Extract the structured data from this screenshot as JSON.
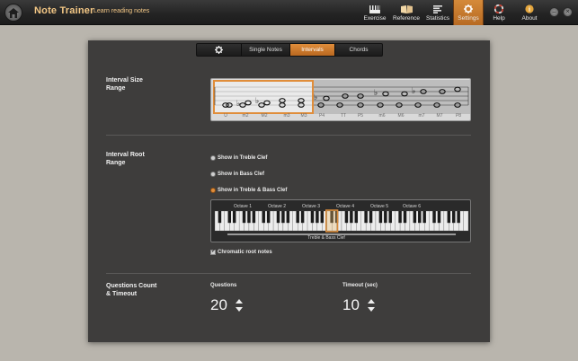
{
  "app": {
    "title": "Note Trainer",
    "subtitle": "Learn reading notes"
  },
  "nav": [
    {
      "label": "Exercise",
      "icon": "piano-icon"
    },
    {
      "label": "Reference",
      "icon": "book-icon"
    },
    {
      "label": "Statistics",
      "icon": "bars-icon"
    },
    {
      "label": "Settings",
      "icon": "gear-icon",
      "active": true
    },
    {
      "label": "Help",
      "icon": "lifebuoy-icon"
    },
    {
      "label": "About",
      "icon": "info-icon"
    }
  ],
  "tabs": [
    {
      "label": "",
      "icon": "gear-icon"
    },
    {
      "label": "Single Notes"
    },
    {
      "label": "Intervals",
      "active": true
    },
    {
      "label": "Chords"
    }
  ],
  "interval_size": {
    "label_line1": "Interval Size",
    "label_line2": "Range",
    "names": [
      "U",
      "m2",
      "M2",
      "m3",
      "M3",
      "P4",
      "TT",
      "P5",
      "m6",
      "M6",
      "m7",
      "M7",
      "P8"
    ],
    "selected_from": "U",
    "selected_to": "M3"
  },
  "interval_root": {
    "label_line1": "Interval Root",
    "label_line2": "Range",
    "options": [
      {
        "label": "Show in Treble Clef",
        "selected": false
      },
      {
        "label": "Show in Bass Clef",
        "selected": false
      },
      {
        "label": "Show in Treble & Bass Clef",
        "selected": true
      }
    ],
    "octaves": [
      "Octave 1",
      "Octave 2",
      "Octave 3",
      "Octave 4",
      "Octave 5",
      "Octave 6"
    ],
    "clef_range_label": "Treble & Bass Clef",
    "chromatic_label": "Chromatic root notes",
    "chromatic_checked": true
  },
  "questions": {
    "label_line1": "Questions Count",
    "label_line2": "& Timeout",
    "count_label": "Questions",
    "count_value": "20",
    "timeout_label": "Timeout (sec)",
    "timeout_value": "10"
  },
  "colors": {
    "accent": "#d88a3a",
    "title": "#f3c785",
    "panel": "#3e3d3c",
    "background": "#b9b5ad"
  }
}
